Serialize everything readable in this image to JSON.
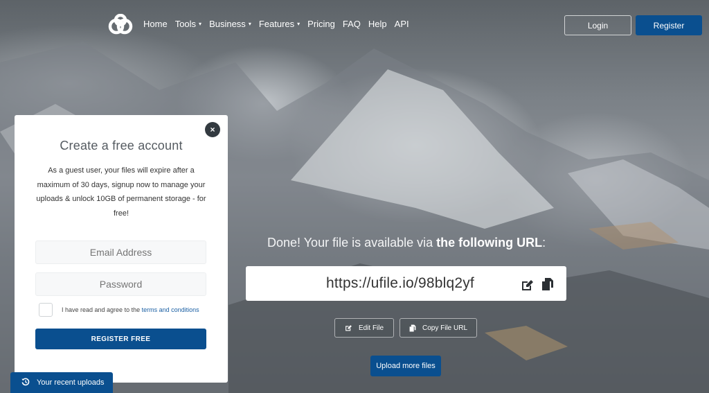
{
  "nav": {
    "links": [
      {
        "label": "Home",
        "has_caret": false
      },
      {
        "label": "Tools",
        "has_caret": true
      },
      {
        "label": "Business",
        "has_caret": true
      },
      {
        "label": "Features",
        "has_caret": true
      },
      {
        "label": "Pricing",
        "has_caret": false
      },
      {
        "label": "FAQ",
        "has_caret": false
      },
      {
        "label": "Help",
        "has_caret": false
      },
      {
        "label": "API",
        "has_caret": false
      }
    ],
    "login_label": "Login",
    "register_label": "Register",
    "caret_glyph": "▾"
  },
  "signup": {
    "close_glyph": "×",
    "title": "Create a free account",
    "description": "As a guest user, your files will expire after a maximum of 30 days, signup now to manage your uploads & unlock 10GB of permanent storage - for free!",
    "email_placeholder": "Email Address",
    "password_placeholder": "Password",
    "terms_prefix": "I have read and agree to the",
    "terms_link": "terms and conditions",
    "submit_label": "REGISTER FREE"
  },
  "recent_uploads": {
    "icon": "history-icon",
    "label": "Your recent uploads"
  },
  "result": {
    "done_prefix": "Done! Your file is available via",
    "done_emphasis": "the following URL",
    "done_suffix": ":",
    "url": "https://ufile.io/98blq2yf",
    "edit_label": "Edit File",
    "copy_label": "Copy File URL",
    "upload_more_label": "Upload more files"
  },
  "colors": {
    "brand_blue": "#0a4f8f",
    "link_blue": "#1a5fa3"
  }
}
